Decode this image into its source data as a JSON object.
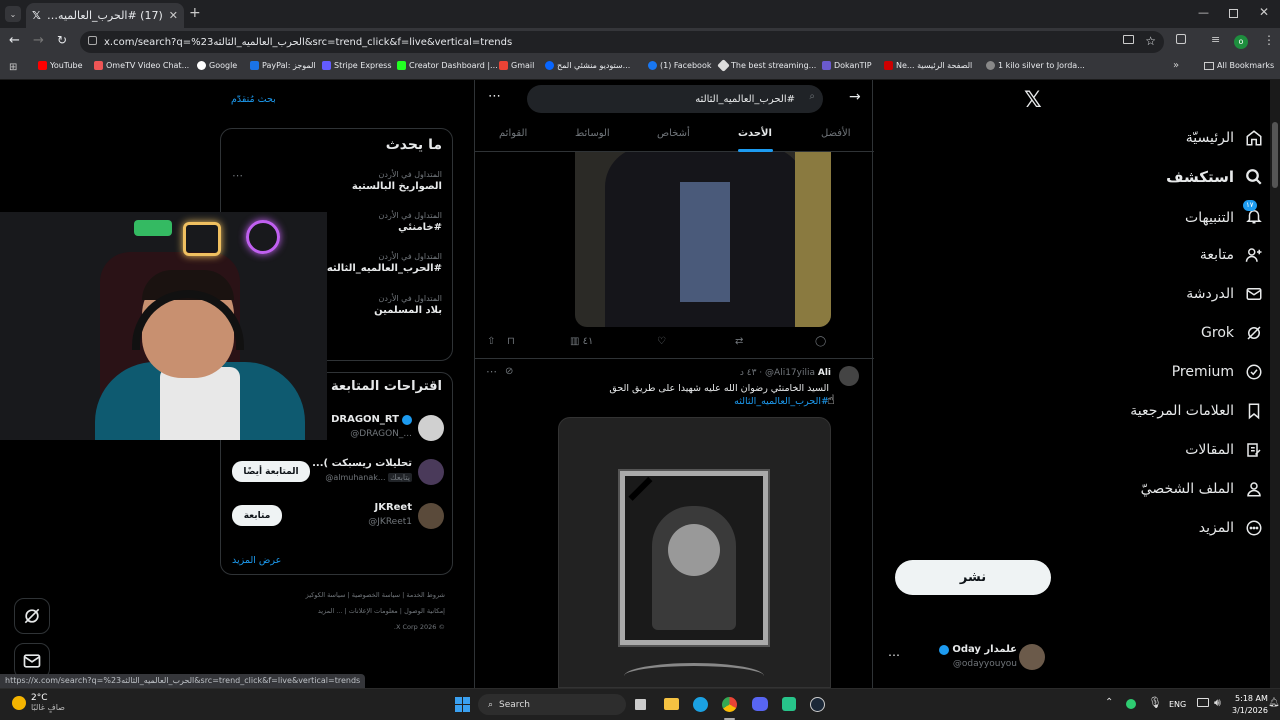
{
  "browser": {
    "tab_title": "(17) #الحرب_العالميه_الثالثه - الب",
    "url": "x.com/search?q=%23الحرب_العالميه_الثالثه&src=trend_click&f=live&vertical=trends",
    "status_url": "https://x.com/search?q=%23الحرب_العالميه_الثالثه&src=trend_click&f=live&vertical=trends",
    "bookmarks": [
      "YouTube",
      "OmeTV Video Chat...",
      "Google",
      "PayPal: الموجز",
      "Stripe Express",
      "Creator Dashboard |...",
      "Gmail",
      "ستوديو منشئي المح...",
      "(1) Facebook",
      "The best streaming...",
      "DokanTIP",
      "Ne... الصفحة الرئيسية",
      "1 kilo silver to Jorda..."
    ],
    "all_bookmarks": "All Bookmarks"
  },
  "nav": {
    "items": [
      {
        "label": "الرئيسيّة",
        "icon": "home-icon"
      },
      {
        "label": "استكشف",
        "icon": "search-icon"
      },
      {
        "label": "التنبيهات",
        "icon": "bell-icon"
      },
      {
        "label": "متابعة",
        "icon": "add-user-icon"
      },
      {
        "label": "الدردشة",
        "icon": "mail-icon"
      },
      {
        "label": "Grok",
        "icon": "grok-icon"
      },
      {
        "label": "Premium",
        "icon": "verified-icon"
      },
      {
        "label": "العلامات المرجعية",
        "icon": "bookmark-icon"
      },
      {
        "label": "المقالات",
        "icon": "article-icon"
      },
      {
        "label": "الملف الشخصيّ",
        "icon": "profile-icon"
      },
      {
        "label": "المزيد",
        "icon": "more-icon"
      }
    ],
    "notif_badge": "١٧",
    "post_button": "نشر",
    "account_name": "Oday علمدار",
    "account_handle": "@odayyouyou"
  },
  "search": {
    "query": "#الحرب_العالميه_الثالثه",
    "tabs": [
      "الأفضل",
      "الأحدث",
      "أشخاص",
      "الوسائط",
      "القوائم"
    ],
    "active_tab": "الأحدث"
  },
  "post1": {
    "views": "٤١"
  },
  "post2": {
    "name": "Ali",
    "handle": "@Ali17yilia",
    "time": "٤٣ د",
    "text": "السيد الخامنئي رضوان الله عليه شهيدا على طريق الحق",
    "hashtag": "#الحرب_العالميه_الثالثه"
  },
  "right": {
    "advanced_search": "بحث مُتقدّم",
    "whats_happening": "ما يحدث",
    "trends": [
      {
        "sub": "المتداول في الأردن",
        "title": "الصواريخ البالستية"
      },
      {
        "sub": "المتداول في الأردن",
        "title": "#خامنئي"
      },
      {
        "sub": "المتداول في الأردن",
        "title": "#الحرب_العالميه_الثالثه"
      },
      {
        "sub": "المتداول في الأردن",
        "title": "بلاد المسلمين"
      }
    ],
    "who_to_follow": "اقتراحات المتابعة",
    "suggestions": [
      {
        "name": "DRAGON_RT",
        "handle": "@DRAGON_..."
      },
      {
        "name": "تحليلات ريسبكت )...",
        "handle": "@almuhanak...",
        "follows_you": "يتابعك",
        "button": "المتابعة أيضًا"
      },
      {
        "name": "JKReet",
        "handle": "@JKReet1",
        "button": "متابعة"
      }
    ],
    "show_more": "عرض المزيد",
    "footer": [
      "شروط الخدمة",
      "سياسة الخصوصية",
      "سياسة الكوكيز",
      "إمكانية الوصول",
      "معلومات الإعلانات",
      "... المزيد",
      "© 2026 X Corp."
    ]
  },
  "taskbar": {
    "temp": "2°C",
    "weather": "صافٍ غالبًا",
    "search": "Search",
    "lang": "ENG",
    "time": "5:18 AM",
    "date": "3/1/2026"
  }
}
